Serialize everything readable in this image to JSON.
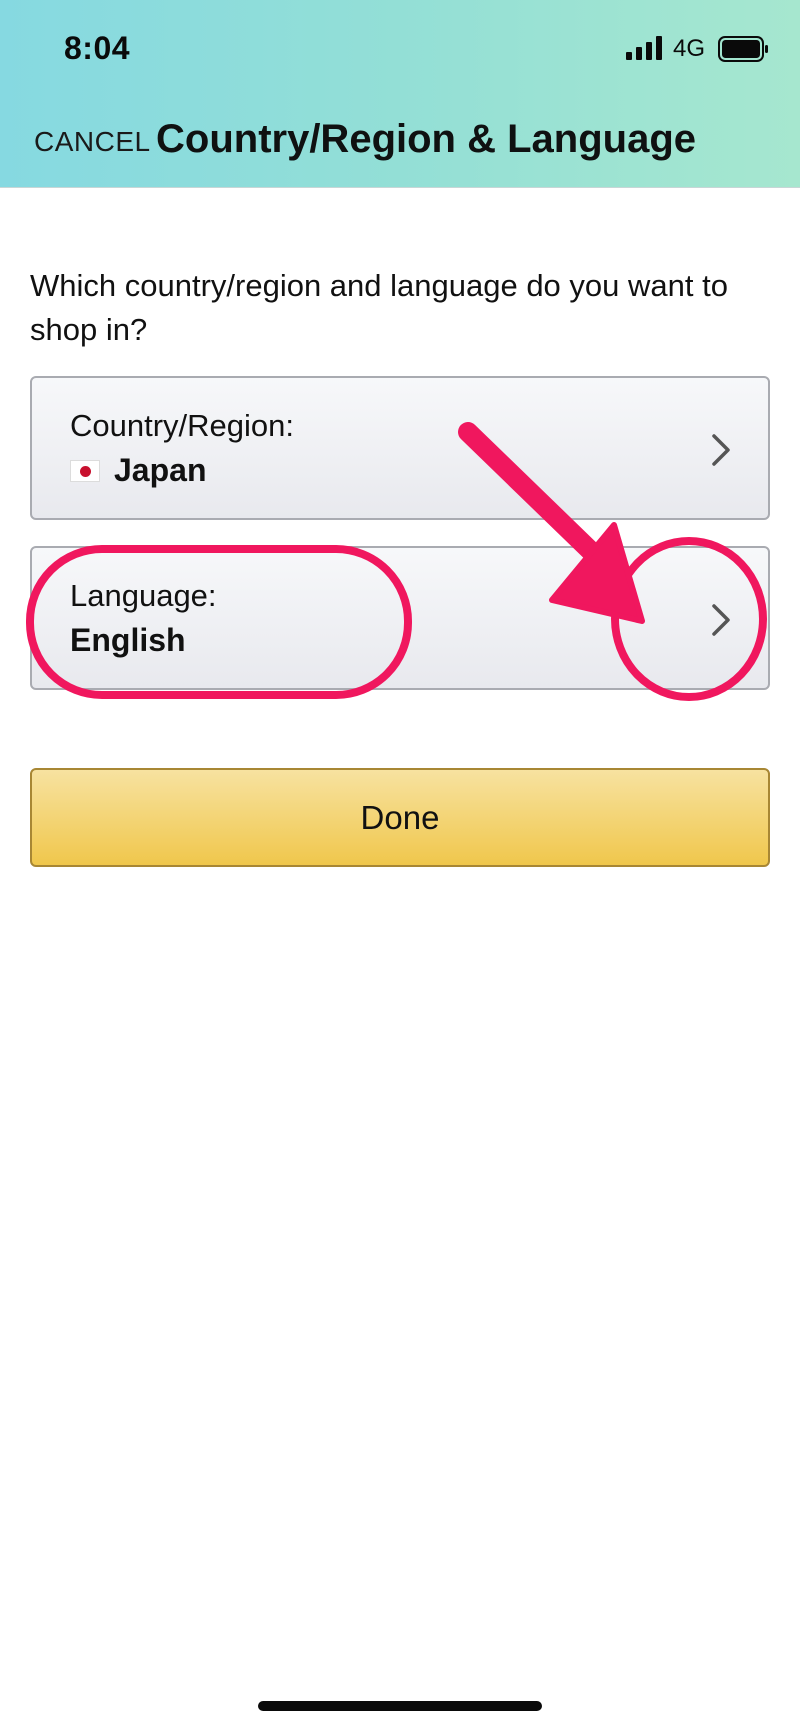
{
  "status_bar": {
    "time": "8:04",
    "network": "4G",
    "icons": [
      "signal-icon",
      "battery-icon"
    ]
  },
  "header": {
    "cancel_label": "CANCEL",
    "title": "Country/Region & Language"
  },
  "question": "Which country/region and language do you want to shop in?",
  "selectors": [
    {
      "label": "Country/Region:",
      "value": "Japan",
      "icon": "japan-flag-icon"
    },
    {
      "label": "Language:",
      "value": "English"
    }
  ],
  "done_label": "Done",
  "colors": {
    "header_gradient_start": "#86d9e1",
    "header_gradient_end": "#a6e7cf",
    "button_yellow": "#f0c74c",
    "annotation_pink": "#f0175e"
  }
}
